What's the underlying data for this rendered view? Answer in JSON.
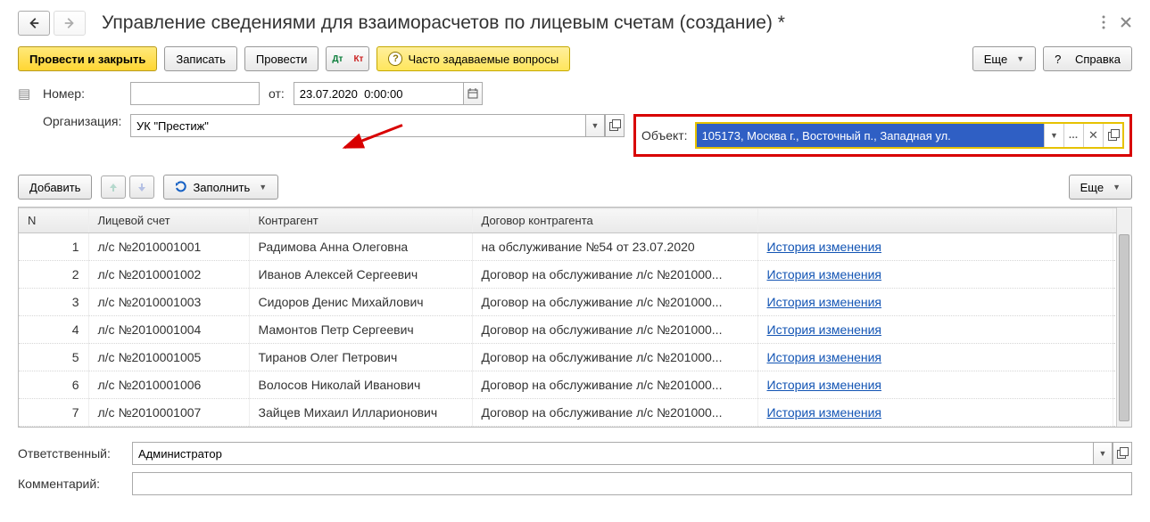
{
  "window": {
    "title": "Управление сведениями для взаиморасчетов по лицевым счетам (создание) *"
  },
  "toolbar": {
    "post_close": "Провести и закрыть",
    "save": "Записать",
    "post": "Провести",
    "dt": "Дт",
    "kt": "Кт",
    "faq": "Часто задаваемые вопросы",
    "more": "Еще",
    "help": "Справка"
  },
  "form": {
    "number_label": "Номер:",
    "number_value": "",
    "from_label": "от:",
    "date_value": "23.07.2020  0:00:00",
    "org_label": "Организация:",
    "org_value": "УК \"Престиж\"",
    "object_label": "Объект:",
    "object_value": "105173, Москва г., Восточный п., Западная ул."
  },
  "table_toolbar": {
    "add": "Добавить",
    "fill": "Заполнить",
    "more": "Еще"
  },
  "table": {
    "headers": {
      "n": "N",
      "account": "Лицевой счет",
      "contragent": "Контрагент",
      "contract": "Договор контрагента",
      "history": ""
    },
    "rows": [
      {
        "n": "1",
        "account": "л/с №2010001001",
        "contragent": "Радимова Анна Олеговна",
        "contract": "на обслуживание №54 от 23.07.2020",
        "history": "История изменения"
      },
      {
        "n": "2",
        "account": "л/с №2010001002",
        "contragent": "Иванов Алексей Сергеевич",
        "contract": "Договор на обслуживание л/с №201000...",
        "history": "История изменения"
      },
      {
        "n": "3",
        "account": "л/с №2010001003",
        "contragent": "Сидоров Денис Михайлович",
        "contract": "Договор на обслуживание л/с №201000...",
        "history": "История изменения"
      },
      {
        "n": "4",
        "account": "л/с №2010001004",
        "contragent": "Мамонтов Петр Сергеевич",
        "contract": "Договор на обслуживание л/с №201000...",
        "history": "История изменения"
      },
      {
        "n": "5",
        "account": "л/с №2010001005",
        "contragent": "Тиранов Олег Петрович",
        "contract": "Договор на обслуживание л/с №201000...",
        "history": "История изменения"
      },
      {
        "n": "6",
        "account": "л/с №2010001006",
        "contragent": "Волосов Николай Иванович",
        "contract": "Договор на обслуживание л/с №201000...",
        "history": "История изменения"
      },
      {
        "n": "7",
        "account": "л/с №2010001007",
        "contragent": "Зайцев Михаил Илларионович",
        "contract": "Договор на обслуживание л/с №201000...",
        "history": "История изменения"
      }
    ]
  },
  "bottom": {
    "responsible_label": "Ответственный:",
    "responsible_value": "Администратор",
    "comment_label": "Комментарий:",
    "comment_value": ""
  }
}
